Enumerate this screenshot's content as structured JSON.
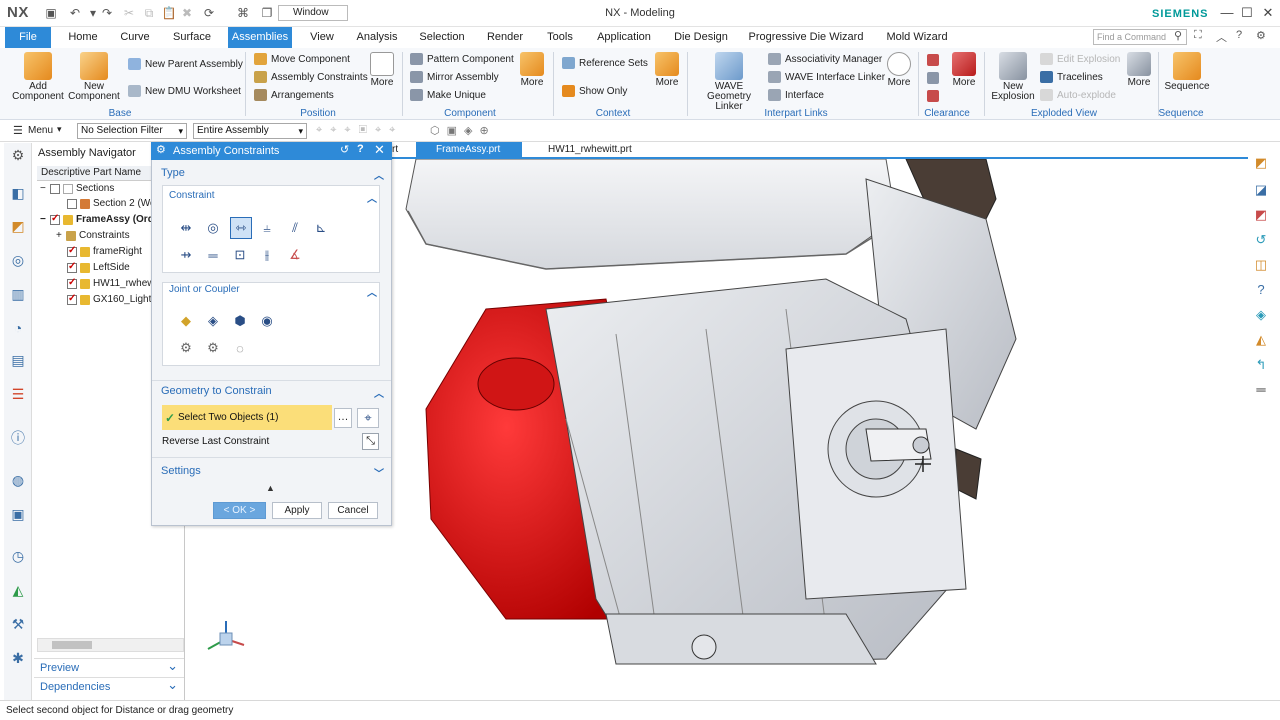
{
  "app": {
    "logo": "NX",
    "title": "NX - Modeling",
    "brand": "SIEMENS",
    "window_select": "Window"
  },
  "menu": {
    "file": "File",
    "tabs": [
      "Home",
      "Curve",
      "Surface",
      "Assemblies",
      "View",
      "Analysis",
      "Selection",
      "Render",
      "Tools",
      "Application",
      "Die Design",
      "Progressive Die Wizard",
      "Mold Wizard"
    ],
    "active": "Assemblies",
    "find_placeholder": "Find a Command"
  },
  "ribbon": {
    "base": {
      "label": "Base",
      "add_component": "Add Component",
      "new_component": "New Component",
      "new_parent_assembly": "New Parent Assembly",
      "new_dmu_worksheet": "New DMU Worksheet"
    },
    "position": {
      "label": "Position",
      "move_component": "Move Component",
      "assembly_constraints": "Assembly Constraints",
      "arrangements": "Arrangements",
      "more": "More"
    },
    "component": {
      "label": "Component",
      "pattern_component": "Pattern Component",
      "mirror_assembly": "Mirror Assembly",
      "make_unique": "Make Unique",
      "more": "More"
    },
    "context": {
      "label": "Context",
      "reference_sets": "Reference Sets",
      "show_only": "Show Only",
      "more": "More"
    },
    "interpart": {
      "label": "Interpart Links",
      "wave_geometry_linker": "WAVE Geometry Linker",
      "associativity_manager": "Associativity Manager",
      "wave_interface_linker": "WAVE Interface Linker",
      "interface": "Interface",
      "more": "More"
    },
    "clearance": {
      "label": "Clearance",
      "more": "More"
    },
    "exploded": {
      "label": "Exploded View",
      "new_explosion": "New Explosion",
      "edit_explosion": "Edit Explosion",
      "tracelines": "Tracelines",
      "auto_explode": "Auto-explode",
      "more": "More"
    },
    "sequence": {
      "label": "Sequence",
      "sequence": "Sequence"
    }
  },
  "toolbar2": {
    "menu": "Menu",
    "selection_filter": "No Selection Filter",
    "scope": "Entire Assembly"
  },
  "navigator": {
    "title": "Assembly Navigator",
    "column": "Descriptive Part Name",
    "items": [
      {
        "label": "Sections",
        "indent": 0
      },
      {
        "label": "Section 2 (Wo",
        "indent": 2
      },
      {
        "label": "FrameAssy (Ord",
        "indent": 0
      },
      {
        "label": "Constraints",
        "indent": 1
      },
      {
        "label": "frameRight",
        "indent": 1
      },
      {
        "label": "LeftSide",
        "indent": 1
      },
      {
        "label": "HW11_rwhew",
        "indent": 1
      },
      {
        "label": "GX160_Light_",
        "indent": 1
      }
    ],
    "preview": "Preview",
    "dependencies": "Dependencies"
  },
  "file_tabs": {
    "partial": "rt",
    "tab1": "FrameAssy.prt",
    "tab2": "HW11_rwhewitt.prt"
  },
  "dialog": {
    "title": "Assembly Constraints",
    "type_section": "Type",
    "constraint_section": "Constraint",
    "joint_section": "Joint or Coupler",
    "geometry_section": "Geometry to Constrain",
    "select_two": "Select Two Objects (1)",
    "reverse_last": "Reverse Last Constraint",
    "settings": "Settings",
    "ok": "< OK >",
    "apply": "Apply",
    "cancel": "Cancel"
  },
  "status": "Select second object for Distance or drag geometry",
  "colors": {
    "accent": "#2e8ad8",
    "selection": "#fbde79",
    "part_red": "#e01b1b"
  }
}
